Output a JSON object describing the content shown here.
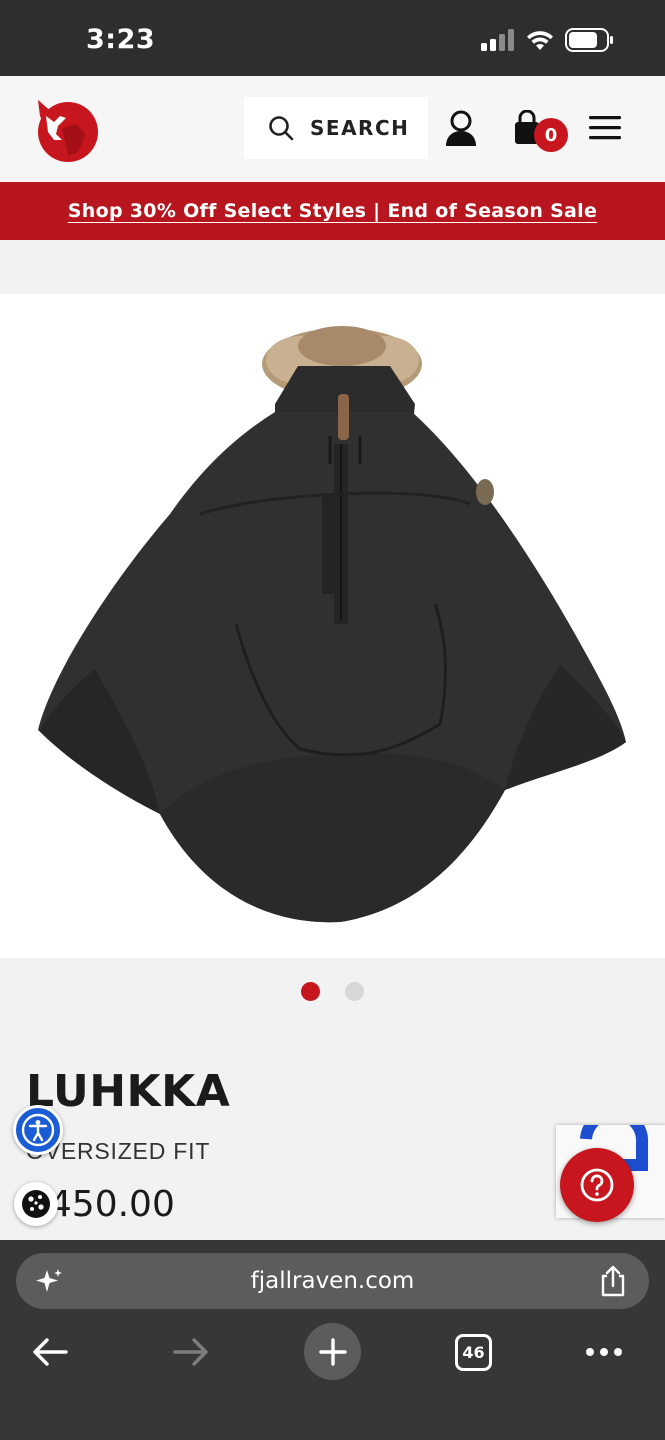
{
  "status_bar": {
    "time": "3:23",
    "icons": [
      "signal-icon",
      "wifi-icon",
      "battery-icon"
    ]
  },
  "header": {
    "logo": "fox-logo-icon",
    "search_label": "SEARCH",
    "cart_count": "0",
    "icons": [
      "search-icon",
      "account-icon",
      "cart-icon",
      "menu-icon"
    ]
  },
  "promo": {
    "text": "Shop 30% Off Select Styles | End of Season Sale"
  },
  "product": {
    "title": "LUHKKA",
    "fit": "OVERSIZED FIT",
    "price": "$450.00",
    "image_count": 2,
    "active_image": 1
  },
  "browser": {
    "url": "fjallraven.com",
    "tab_count": "46"
  },
  "colors": {
    "brand_red": "#c7161d",
    "promo_red": "#b7161f",
    "status_bg": "#2e2e2e",
    "browser_bg": "#373737",
    "accessibility_blue": "#1a5bd6"
  }
}
